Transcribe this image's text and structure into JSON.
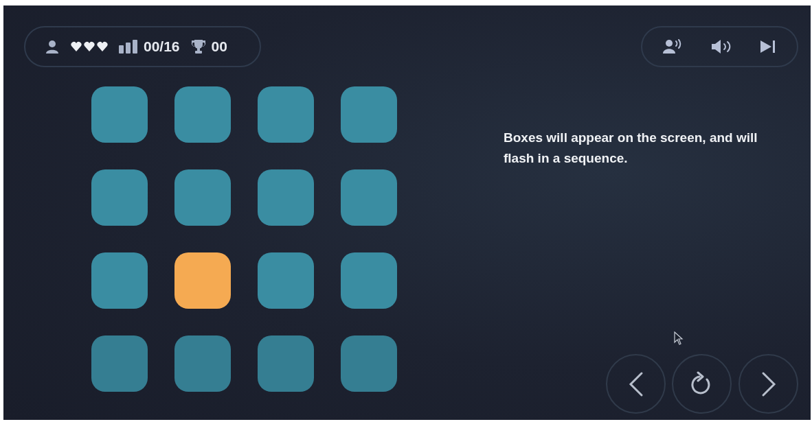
{
  "status_bar": {
    "progress": "00/16",
    "trophies": "00"
  },
  "tiles": [
    {
      "lit": false
    },
    {
      "lit": false
    },
    {
      "lit": false
    },
    {
      "lit": false
    },
    {
      "lit": false
    },
    {
      "lit": false
    },
    {
      "lit": false
    },
    {
      "lit": false
    },
    {
      "lit": false
    },
    {
      "lit": true
    },
    {
      "lit": false
    },
    {
      "lit": false
    },
    {
      "lit": false
    },
    {
      "lit": false
    },
    {
      "lit": false
    },
    {
      "lit": false
    }
  ],
  "instructions": "Boxes will appear on the screen, and will flash in a sequence."
}
